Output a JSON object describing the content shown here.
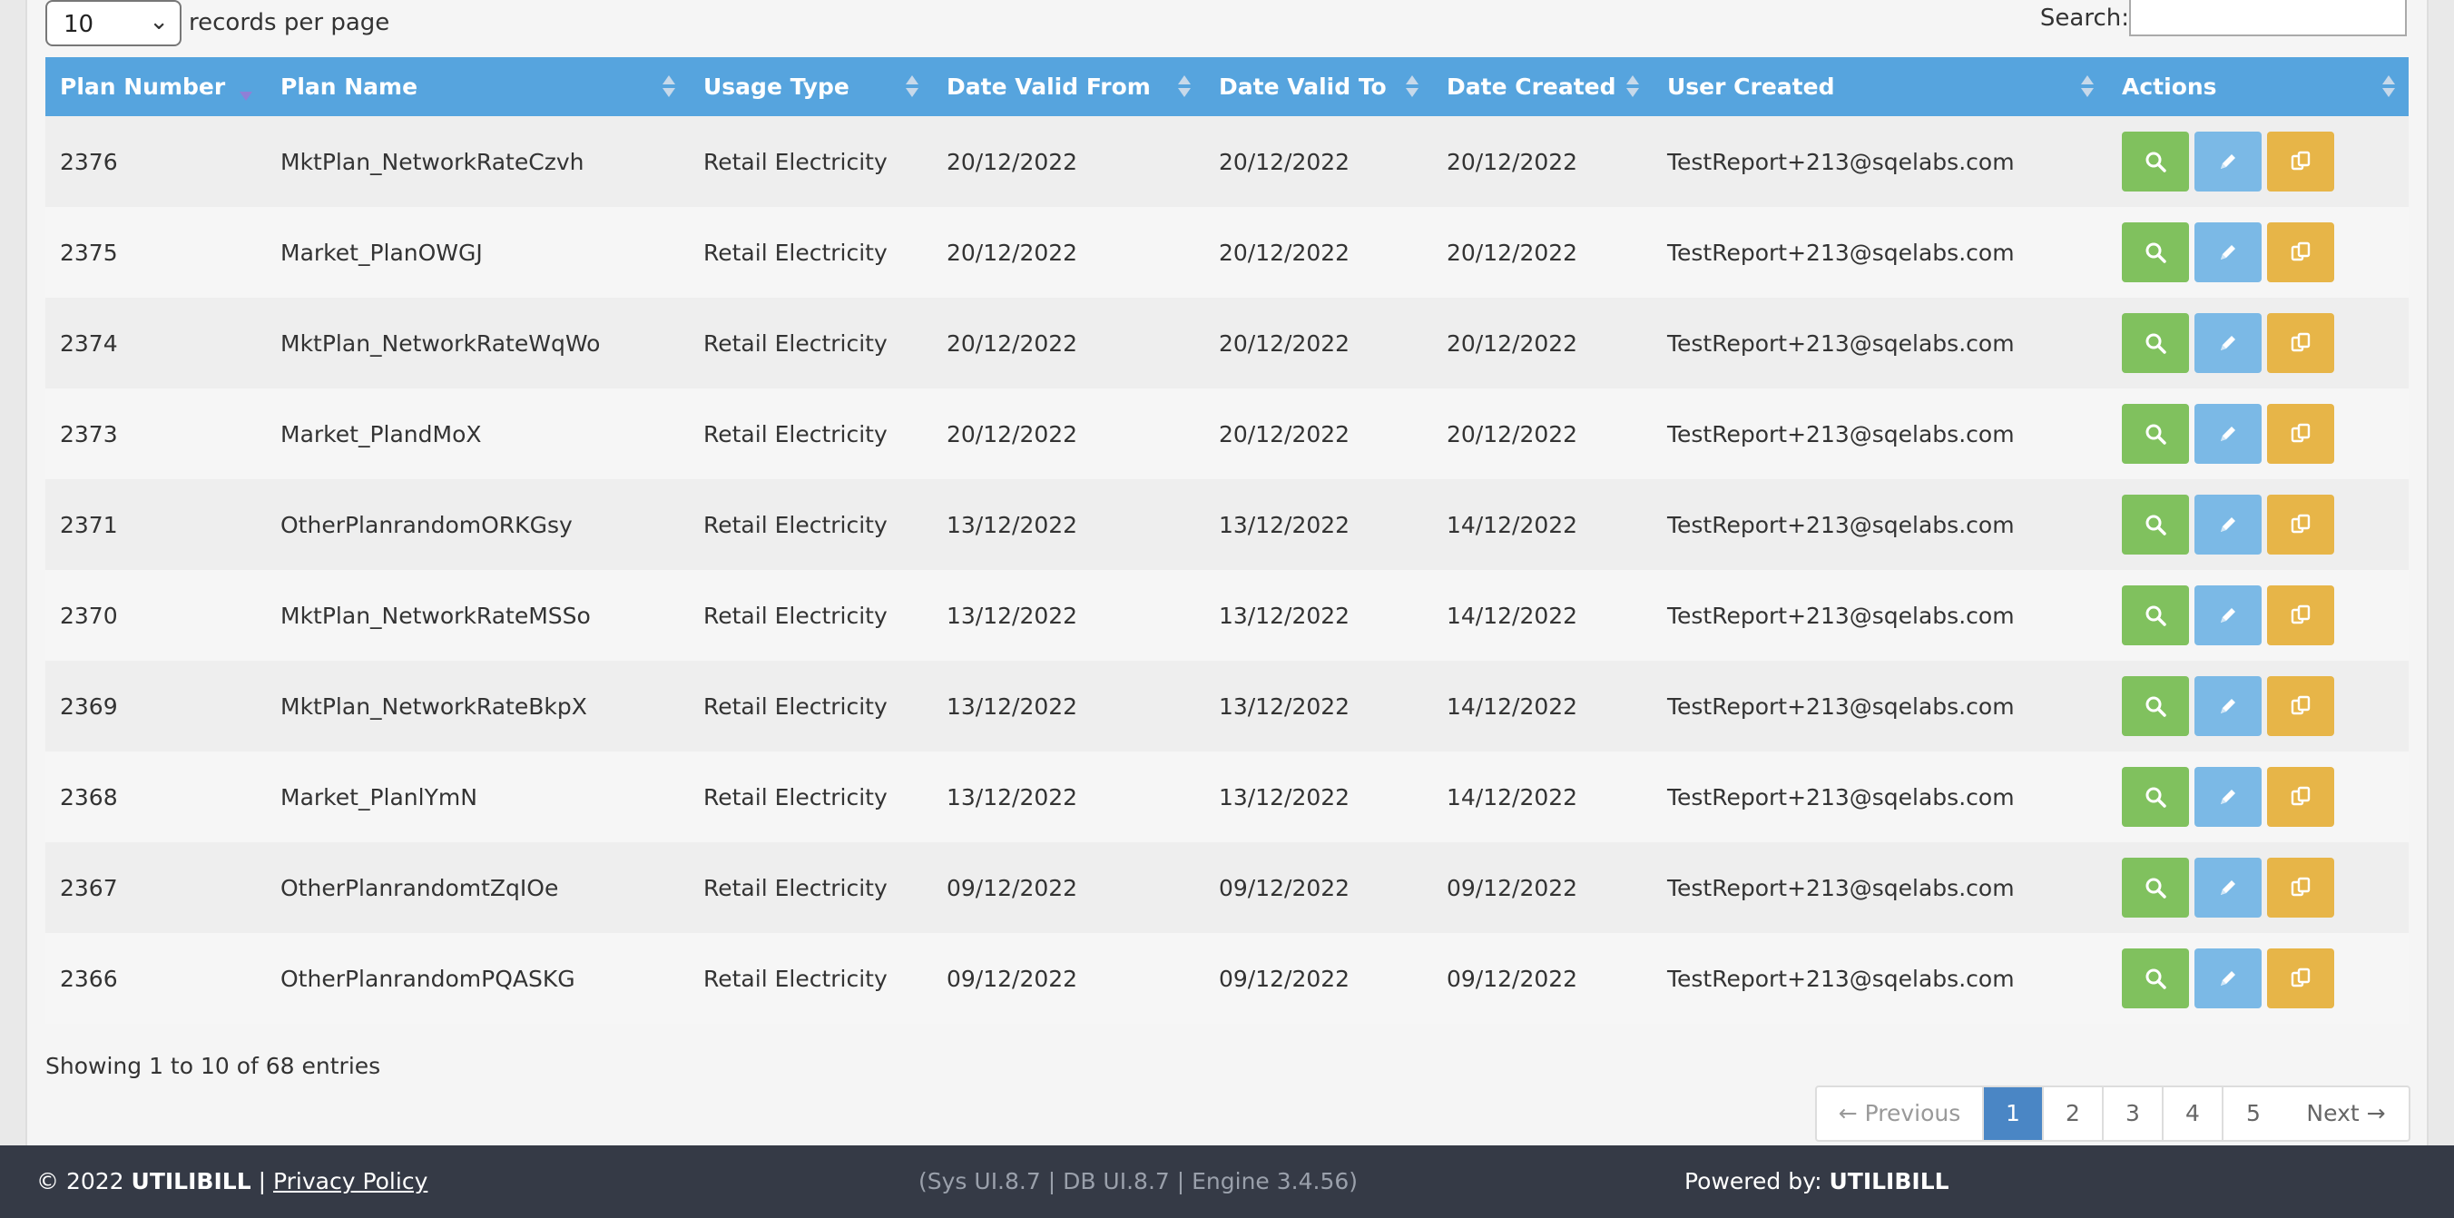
{
  "controls": {
    "length_value": "10",
    "length_label": "records per page",
    "search_label": "Search:",
    "search_value": ""
  },
  "table": {
    "columns": [
      {
        "label": "Plan Number",
        "sort": "desc"
      },
      {
        "label": "Plan Name",
        "sort": "both"
      },
      {
        "label": "Usage Type",
        "sort": "both"
      },
      {
        "label": "Date Valid From",
        "sort": "both"
      },
      {
        "label": "Date Valid To",
        "sort": "both"
      },
      {
        "label": "Date Created",
        "sort": "both"
      },
      {
        "label": "User Created",
        "sort": "both"
      },
      {
        "label": "Actions",
        "sort": "both"
      }
    ],
    "rows": [
      {
        "plan_number": "2376",
        "plan_name": "MktPlan_NetworkRateCzvh",
        "usage_type": "Retail Electricity",
        "valid_from": "20/12/2022",
        "valid_to": "20/12/2022",
        "created": "20/12/2022",
        "user": "TestReport+213@sqelabs.com"
      },
      {
        "plan_number": "2375",
        "plan_name": "Market_PlanOWGJ",
        "usage_type": "Retail Electricity",
        "valid_from": "20/12/2022",
        "valid_to": "20/12/2022",
        "created": "20/12/2022",
        "user": "TestReport+213@sqelabs.com"
      },
      {
        "plan_number": "2374",
        "plan_name": "MktPlan_NetworkRateWqWo",
        "usage_type": "Retail Electricity",
        "valid_from": "20/12/2022",
        "valid_to": "20/12/2022",
        "created": "20/12/2022",
        "user": "TestReport+213@sqelabs.com"
      },
      {
        "plan_number": "2373",
        "plan_name": "Market_PlandMoX",
        "usage_type": "Retail Electricity",
        "valid_from": "20/12/2022",
        "valid_to": "20/12/2022",
        "created": "20/12/2022",
        "user": "TestReport+213@sqelabs.com"
      },
      {
        "plan_number": "2371",
        "plan_name": "OtherPlanrandomORKGsy",
        "usage_type": "Retail Electricity",
        "valid_from": "13/12/2022",
        "valid_to": "13/12/2022",
        "created": "14/12/2022",
        "user": "TestReport+213@sqelabs.com"
      },
      {
        "plan_number": "2370",
        "plan_name": "MktPlan_NetworkRateMSSo",
        "usage_type": "Retail Electricity",
        "valid_from": "13/12/2022",
        "valid_to": "13/12/2022",
        "created": "14/12/2022",
        "user": "TestReport+213@sqelabs.com"
      },
      {
        "plan_number": "2369",
        "plan_name": "MktPlan_NetworkRateBkpX",
        "usage_type": "Retail Electricity",
        "valid_from": "13/12/2022",
        "valid_to": "13/12/2022",
        "created": "14/12/2022",
        "user": "TestReport+213@sqelabs.com"
      },
      {
        "plan_number": "2368",
        "plan_name": "Market_PlanlYmN",
        "usage_type": "Retail Electricity",
        "valid_from": "13/12/2022",
        "valid_to": "13/12/2022",
        "created": "14/12/2022",
        "user": "TestReport+213@sqelabs.com"
      },
      {
        "plan_number": "2367",
        "plan_name": "OtherPlanrandomtZqIOe",
        "usage_type": "Retail Electricity",
        "valid_from": "09/12/2022",
        "valid_to": "09/12/2022",
        "created": "09/12/2022",
        "user": "TestReport+213@sqelabs.com"
      },
      {
        "plan_number": "2366",
        "plan_name": "OtherPlanrandomPQASKG",
        "usage_type": "Retail Electricity",
        "valid_from": "09/12/2022",
        "valid_to": "09/12/2022",
        "created": "09/12/2022",
        "user": "TestReport+213@sqelabs.com"
      }
    ],
    "action_icons": [
      "search-icon",
      "pencil-icon",
      "copy-icon"
    ],
    "action_colors": {
      "view": "#80c15e",
      "edit": "#7bb9e6",
      "copy": "#e7b548"
    }
  },
  "info": "Showing 1 to 10 of 68 entries",
  "pagination": {
    "previous": "← Previous",
    "pages": [
      "1",
      "2",
      "3",
      "4",
      "5"
    ],
    "active_page": "1",
    "next": "Next →"
  },
  "footer": {
    "copyright": "© 2022",
    "brand": "UTILIBILL",
    "separator": "|",
    "privacy": "Privacy Policy",
    "version": "(Sys UI.8.7 | DB UI.8.7 | Engine 3.4.56)",
    "powered_label": "Powered by:",
    "powered_brand": "UTILIBILL"
  },
  "colors": {
    "header_bg": "#56a4de",
    "footer_bg": "#353a46",
    "active_page": "#4a86c5"
  }
}
